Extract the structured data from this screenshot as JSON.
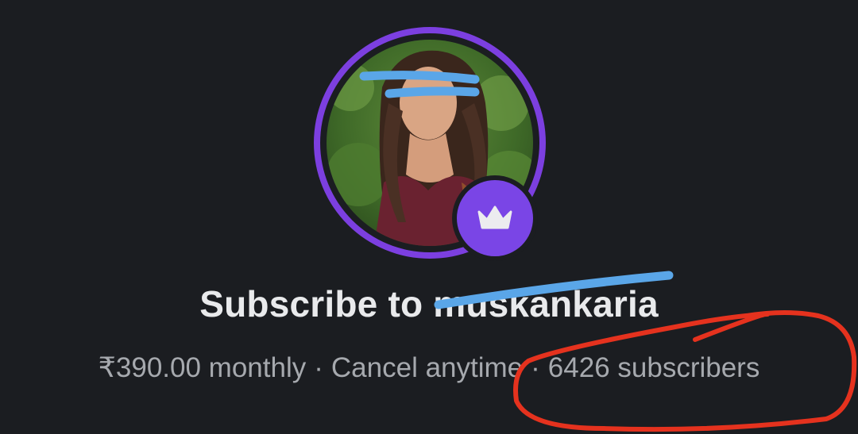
{
  "creator": {
    "avatar_alt": "profile photo",
    "title_prefix": "Subscribe to",
    "username": "muskankaria"
  },
  "plan": {
    "price": "₹390.00 monthly",
    "cancel_text": "Cancel anytime",
    "subscribers": "6426 subscribers"
  },
  "colors": {
    "background": "#1b1d21",
    "accent": "#7c3fe0",
    "title": "#e9eaec",
    "subtitle": "#a6a9ae",
    "scribble_blue": "#5aa6e8",
    "annotation_red": "#e5321e"
  },
  "icons": {
    "badge": "crown-icon"
  }
}
